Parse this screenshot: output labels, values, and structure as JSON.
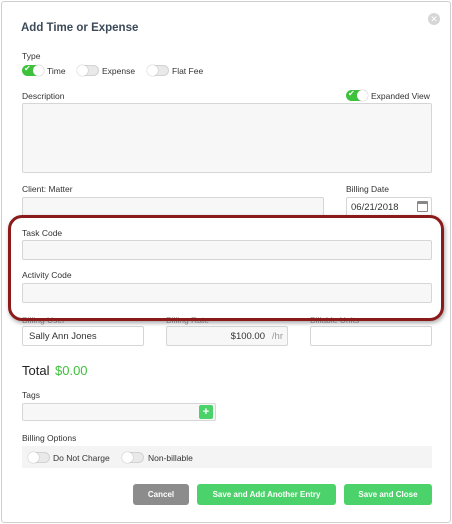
{
  "dialog": {
    "title": "Add Time or Expense"
  },
  "type": {
    "label": "Type",
    "options": [
      {
        "label": "Time",
        "on": true
      },
      {
        "label": "Expense",
        "on": false
      },
      {
        "label": "Flat Fee",
        "on": false
      }
    ]
  },
  "description": {
    "label": "Description",
    "value": ""
  },
  "expanded_view": {
    "label": "Expanded View",
    "on": true
  },
  "client_matter": {
    "label": "Client: Matter",
    "value": ""
  },
  "billing_date": {
    "label": "Billing Date",
    "value": "06/21/2018"
  },
  "task_code": {
    "label": "Task Code",
    "value": ""
  },
  "activity_code": {
    "label": "Activity Code",
    "value": ""
  },
  "billing_user": {
    "label": "Billing User",
    "value": "Sally Ann Jones"
  },
  "billing_rate": {
    "label": "Billing Rate",
    "value": "$100.00",
    "unit": "/hr"
  },
  "billable_units": {
    "label": "Billable Units",
    "value": ""
  },
  "total": {
    "label": "Total",
    "value": "$0.00"
  },
  "tags": {
    "label": "Tags",
    "add_icon": "+"
  },
  "billing_options": {
    "label": "Billing Options",
    "options": [
      {
        "label": "Do Not Charge",
        "on": false
      },
      {
        "label": "Non-billable",
        "on": false
      }
    ]
  },
  "buttons": {
    "cancel": "Cancel",
    "save_add": "Save and Add Another Entry",
    "save_close": "Save and Close"
  },
  "colors": {
    "accent_green": "#4cd26a",
    "annotation_red": "#8b1a1a"
  }
}
